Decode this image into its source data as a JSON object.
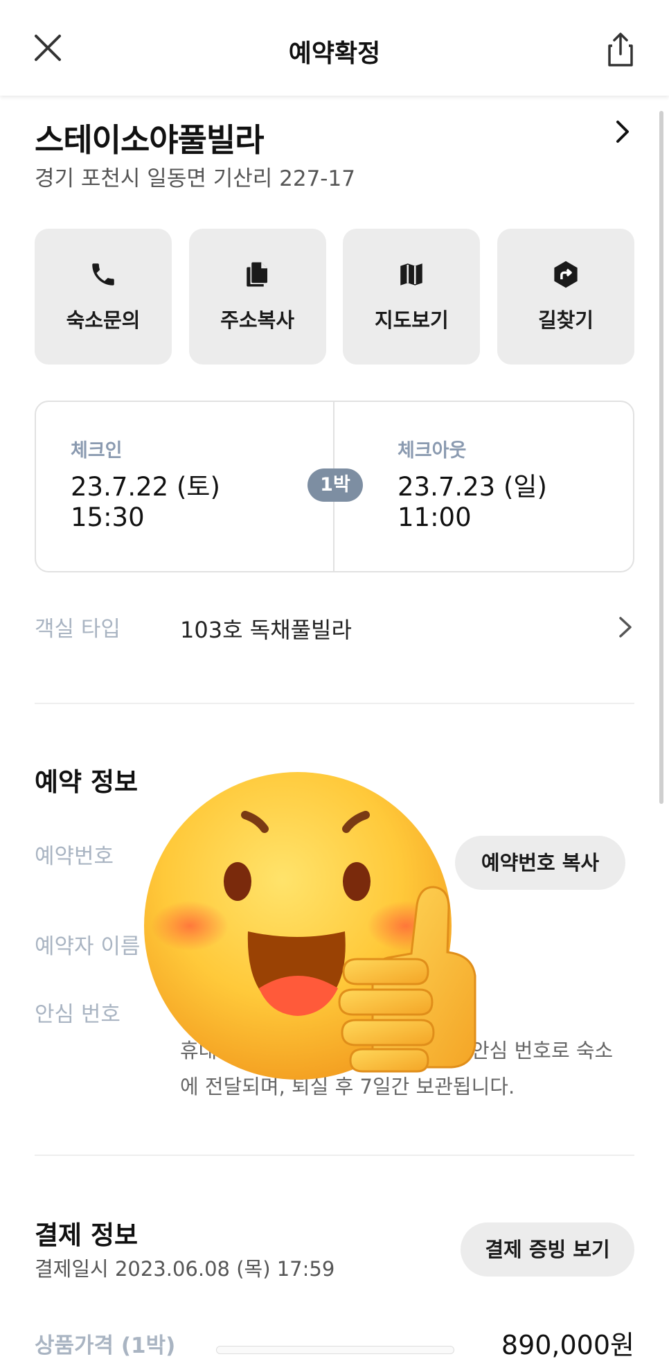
{
  "header": {
    "title": "예약확정",
    "close_icon": "close-icon",
    "share_icon": "share-icon"
  },
  "hotel": {
    "name": "스테이소야풀빌라",
    "address": "경기 포천시 일동면 기산리 227-17"
  },
  "actions": [
    {
      "label": "숙소문의",
      "icon": "phone-icon"
    },
    {
      "label": "주소복사",
      "icon": "copy-icon"
    },
    {
      "label": "지도보기",
      "icon": "map-icon"
    },
    {
      "label": "길찾기",
      "icon": "directions-icon"
    }
  ],
  "stay": {
    "checkin_label": "체크인",
    "checkin_date": "23.7.22 (토)",
    "checkin_time": "15:30",
    "nights": "1박",
    "checkout_label": "체크아웃",
    "checkout_date": "23.7.23 (일)",
    "checkout_time": "11:00"
  },
  "room": {
    "label": "객실 타입",
    "value": "103호 독채풀빌라"
  },
  "reservation": {
    "title": "예약 정보",
    "number_label": "예약번호",
    "copy_button": "예약번호 복사",
    "name_label": "예약자 이름",
    "safe_number_label": "안심 번호",
    "notice_line1_left": "휴대",
    "notice_line1_right": "안심 번호로 숙소",
    "notice_line2": "에 전달되며, 퇴실 후 7일간 보관됩니다."
  },
  "payment": {
    "title": "결제 정보",
    "date": "결제일시 2023.06.08 (목) 17:59",
    "receipt_button": "결제 증빙 보기",
    "price_label": "상품가격 (1박)",
    "price_value": "890,000원"
  },
  "colors": {
    "accent_badge": "#7d8ea2",
    "muted_label": "#a9b4c2",
    "card_bg": "#ececec"
  }
}
